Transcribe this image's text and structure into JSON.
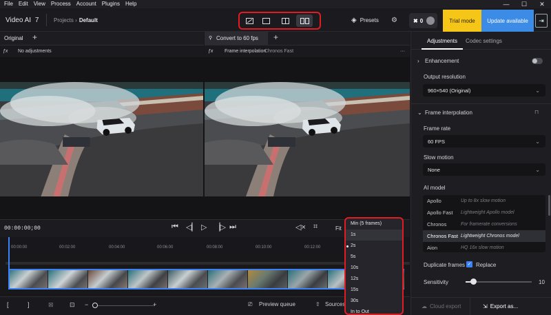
{
  "menu": [
    "File",
    "Edit",
    "View",
    "Process",
    "Account",
    "Plugins",
    "Help"
  ],
  "window_controls": {
    "minimize": "—",
    "maximize": "☐",
    "close": "✕"
  },
  "app": {
    "name": "Video AI",
    "version": "7"
  },
  "breadcrumb": {
    "parent": "Projects",
    "current": "Default"
  },
  "toolbar": {
    "presets": "Presets",
    "credits": "0",
    "trial": "Trial mode",
    "update": "Update available"
  },
  "preview": {
    "left_tab": "Original",
    "right_tab": "Convert to 60 fps",
    "left_sub": "No adjustments",
    "right_sub_label": "Frame interpolation",
    "right_sub_model": "Chronos Fast"
  },
  "transport": {
    "timecode": "00:00:00;00",
    "fit": "Fit"
  },
  "ruler_ticks": [
    "00:00:00",
    "00:02:00",
    "00:04:00",
    "00:06:00",
    "00:08:00",
    "00:10:00",
    "00:12:00"
  ],
  "bottombar": {
    "preview_queue": "Preview queue",
    "sources": "Sources"
  },
  "dropdown": {
    "items": [
      "Min (5 frames)",
      "1s",
      "2s",
      "5s",
      "10s",
      "12s",
      "15s",
      "30s",
      "In to Out"
    ],
    "selected": "2s",
    "hover": "1s"
  },
  "sidebar": {
    "tabs": {
      "adjustments": "Adjustments",
      "codec": "Codec settings"
    },
    "enhancement": "Enhancement",
    "output_resolution_label": "Output resolution",
    "output_resolution": "960×540 (Original)",
    "frame_interp": "Frame interpolation",
    "frame_rate_label": "Frame rate",
    "frame_rate": "60 FPS",
    "slow_motion_label": "Slow motion",
    "slow_motion": "None",
    "ai_model_label": "AI model",
    "ai_models": [
      {
        "name": "Apollo",
        "desc": "Up to 8x slow motion"
      },
      {
        "name": "Apollo Fast",
        "desc": "Lightweight Apollo model"
      },
      {
        "name": "Chronos",
        "desc": "For framerate conversions"
      },
      {
        "name": "Chronos Fast",
        "desc": "Lightweight Chronos model"
      },
      {
        "name": "Aion",
        "desc": "HQ 16x slow motion"
      }
    ],
    "selected_model": "Chronos Fast",
    "duplicate_frames_label": "Duplicate frames",
    "replace_label": "Replace",
    "sensitivity_label": "Sensitivity",
    "sensitivity_value": "10",
    "sensitivity_fraction": 0.11,
    "cloud_export": "Cloud export",
    "export": "Export as..."
  }
}
